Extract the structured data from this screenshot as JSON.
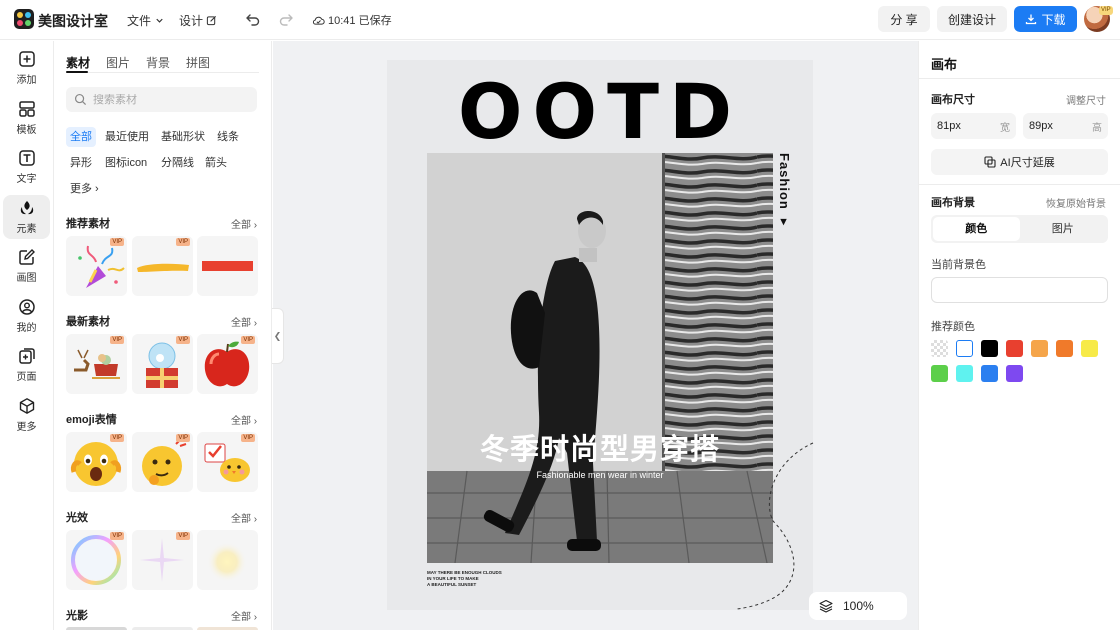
{
  "app": {
    "name": "美图设计室"
  },
  "topbar": {
    "file_menu": "文件",
    "design_menu": "设计",
    "save_status": "10:41 已保存",
    "share_label": "分 享",
    "create_label": "创建设计",
    "download_label": "下载",
    "avatar_badge": "VIP"
  },
  "rail": {
    "items": [
      {
        "label": "添加",
        "icon": "plus-square-icon"
      },
      {
        "label": "模板",
        "icon": "template-grid-icon"
      },
      {
        "label": "文字",
        "icon": "text-icon"
      },
      {
        "label": "元素",
        "icon": "shapes-icon"
      },
      {
        "label": "画图",
        "icon": "draw-pen-icon"
      },
      {
        "label": "我的",
        "icon": "user-icon"
      },
      {
        "label": "页面",
        "icon": "page-add-icon"
      },
      {
        "label": "更多",
        "icon": "cube-icon"
      }
    ],
    "active_index": 3
  },
  "asset_panel": {
    "tabs": [
      "素材",
      "图片",
      "背景",
      "拼图"
    ],
    "active_tab": 0,
    "search_placeholder": "搜索素材",
    "chips": [
      "全部",
      "最近使用",
      "基础形状",
      "线条",
      "异形",
      "图标icon",
      "分隔线",
      "箭头",
      "更多"
    ],
    "active_chip": 0,
    "all_label": "全部",
    "vip_label": "VIP",
    "sections": [
      {
        "title": "推荐素材",
        "items": [
          "party-popper",
          "yellow-brush-stroke",
          "red-rectangle"
        ]
      },
      {
        "title": "最新素材",
        "items": [
          "reindeer-sleigh",
          "snow-globe-gift",
          "red-apple"
        ]
      },
      {
        "title": "emoji表情",
        "items": [
          "shocked-face-emoji",
          "thinking-face-emoji",
          "chick-sign-emoji"
        ]
      },
      {
        "title": "光效",
        "items": [
          "rainbow-bubble-ring",
          "sparkle-star",
          "soft-glow"
        ]
      },
      {
        "title": "光影",
        "items": []
      }
    ]
  },
  "poster": {
    "headline": "OOTD",
    "side_text": "Fashion",
    "title": "冬季时尚型男穿搭",
    "subtitle": "Fashionable men wear in winter",
    "small_lines": [
      "MAY THERE BE ENOUGH CLOUDS",
      "IN YOUR LIFE TO MAKE",
      "A BEAUTIFUL SUNSET"
    ]
  },
  "zoom": {
    "level": "100%"
  },
  "right_panel": {
    "title": "画布",
    "size_label": "画布尺寸",
    "adjust_size_label": "调整尺寸",
    "width_value": "81px",
    "width_unit": "宽",
    "height_value": "89px",
    "height_unit": "高",
    "ai_extend_label": "AI尺寸延展",
    "bg_label": "画布背景",
    "restore_bg_label": "恢复原始背景",
    "seg_color": "颜色",
    "seg_image": "图片",
    "current_bg_label": "当前背景色",
    "current_bg_color": "#ffffff",
    "recommend_label": "推荐颜色",
    "recommended_colors": [
      "transparent",
      "#ffffff",
      "#000000",
      "#e8402f",
      "#f5a54a",
      "#f07a2a",
      "#f7ea48",
      "#5ccf4a",
      "#5ff2ef",
      "#2b7ff0",
      "#7e49f0"
    ]
  },
  "colors": {
    "accent": "#1c7cf4",
    "vip_badge": "#f6b38a",
    "active_chip_bg": "#e5f0ff"
  }
}
